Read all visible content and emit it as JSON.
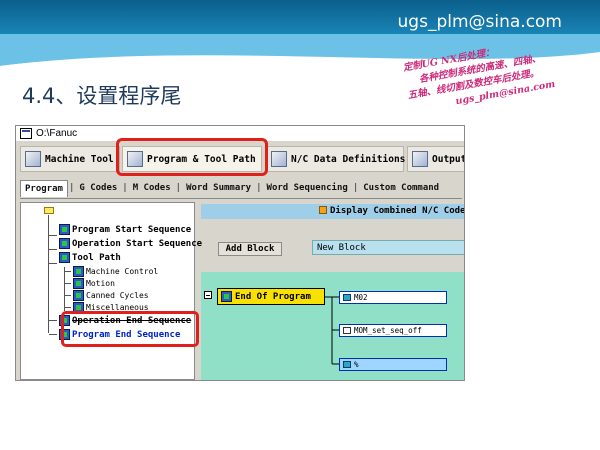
{
  "slide": {
    "email": "ugs_plm@sina.com",
    "title": "4.4、设置程序尾",
    "stamp_lines": [
      "定制UG NX后处理：",
      "各种控制系统的高速、四轴、",
      "五轴、线切割及数控车后处理。",
      "ugs_plm@sina.com"
    ]
  },
  "window": {
    "title": "O:\\Fanuc",
    "tabs": [
      {
        "label": "Machine Tool",
        "icon": "machine-tool-icon"
      },
      {
        "label": "Program & Tool Path",
        "icon": "program-toolpath-icon"
      },
      {
        "label": "N/C Data Definitions",
        "icon": "nc-data-icon"
      },
      {
        "label": "Output",
        "icon": "output-icon"
      }
    ],
    "subtabs": [
      "Program",
      "G Codes",
      "M Codes",
      "Word Summary",
      "Word Sequencing",
      "Custom Command"
    ]
  },
  "tree": {
    "items": [
      {
        "label": "Program Start Sequence"
      },
      {
        "label": "Operation Start Sequence"
      },
      {
        "label": "Tool Path"
      },
      {
        "label": "Machine Control"
      },
      {
        "label": "Motion"
      },
      {
        "label": "Canned Cycles"
      },
      {
        "label": "Miscellaneous"
      },
      {
        "label": "Operation End Sequence"
      },
      {
        "label": "Program End Sequence"
      }
    ]
  },
  "editor": {
    "display_combined": "Display Combined N/C Code",
    "add_block": "Add Block",
    "new_block": "New Block",
    "event_block": "End Of Program",
    "commands": [
      "M02",
      "MOM_set_seq_off",
      "%"
    ]
  },
  "colors": {
    "highlight_box": "#e0211b",
    "header_blue": "#1d8ec2",
    "event_yellow": "#f8e000",
    "canvas_green": "#8fe0c6"
  }
}
